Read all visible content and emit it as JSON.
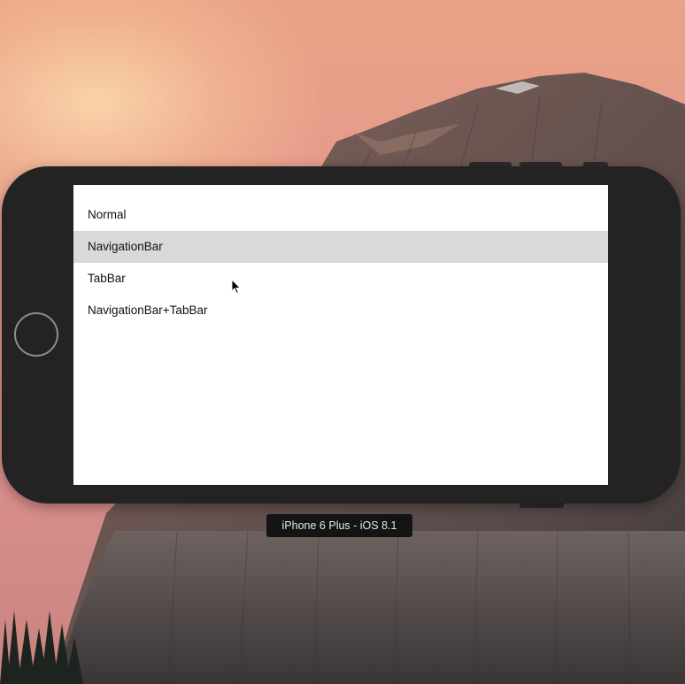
{
  "simulator": {
    "device_label": "iPhone 6 Plus - iOS 8.1"
  },
  "app": {
    "table": {
      "rows": [
        {
          "label": "Normal",
          "selected": false
        },
        {
          "label": "NavigationBar",
          "selected": true
        },
        {
          "label": "TabBar",
          "selected": false
        },
        {
          "label": "NavigationBar+TabBar",
          "selected": false
        }
      ]
    }
  },
  "colors": {
    "device_body": "#232323",
    "screen_background": "#ffffff",
    "selected_row": "#d9d9d9",
    "label_background": "#141414"
  },
  "icons": {
    "home_button": "home-button-icon",
    "cursor": "mouse-pointer-icon"
  }
}
